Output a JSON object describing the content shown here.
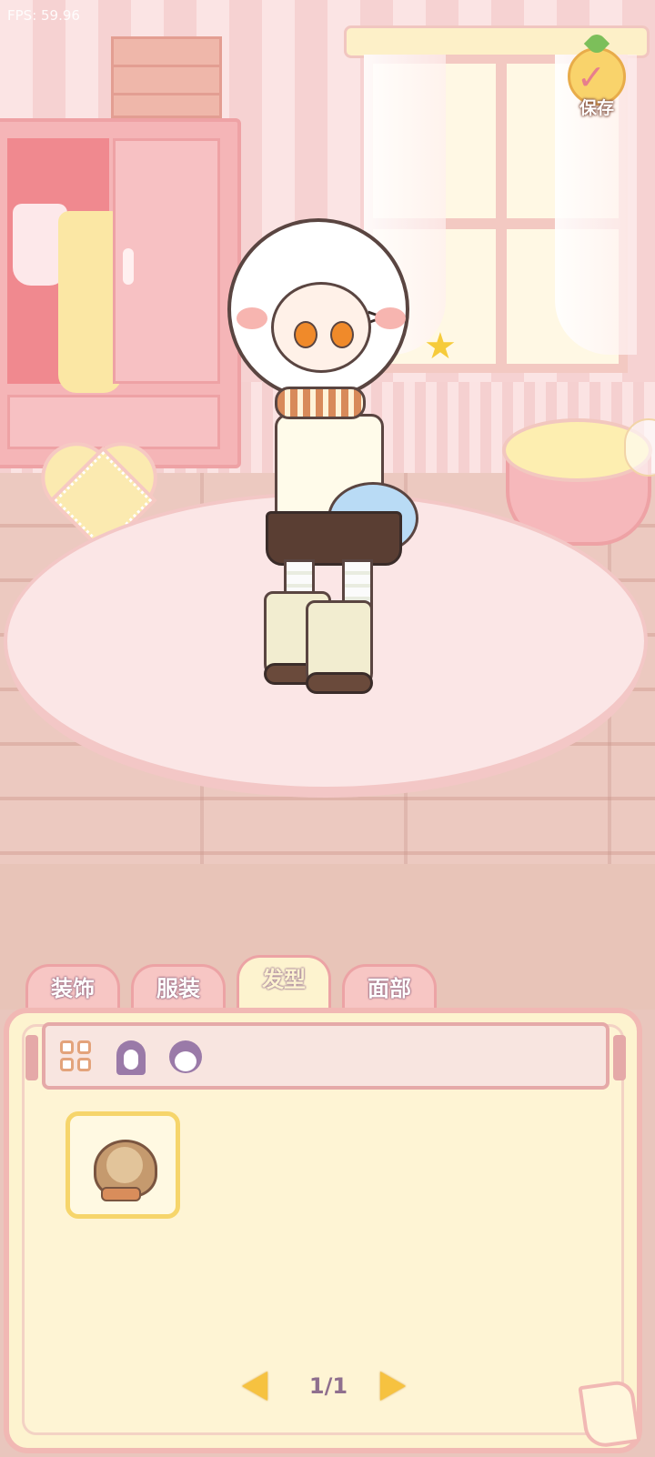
{
  "hud": {
    "fps": "FPS: 59.96"
  },
  "save_button": {
    "label": "保存",
    "icon": "check-icon"
  },
  "tabs": [
    {
      "label": "装饰",
      "active": false
    },
    {
      "label": "服装",
      "active": false
    },
    {
      "label": "发型",
      "active": true
    },
    {
      "label": "面部",
      "active": false
    }
  ],
  "subtabs": [
    {
      "icon": "grid-icon",
      "selected": true
    },
    {
      "icon": "long-hair-icon",
      "selected": false
    },
    {
      "icon": "short-hair-icon",
      "selected": false
    }
  ],
  "items": [
    {
      "icon": "hairstyle-item-icon",
      "selected": true
    }
  ],
  "pager": {
    "page": "1/1"
  },
  "colors": {
    "tab_pink": "#f7c6c4",
    "panel_cream": "#fdf3cf",
    "accent_yellow": "#f6c240",
    "text_purple": "#8f6f8e"
  }
}
